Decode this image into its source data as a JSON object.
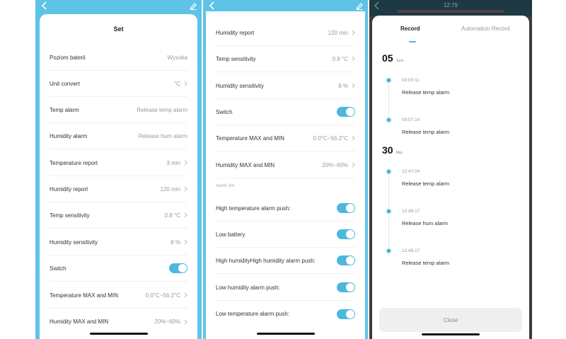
{
  "colors": {
    "accent": "#4db7dd",
    "header": "#5ec3e6"
  },
  "icons": {
    "back": "chevron-left-icon",
    "edit": "pencil-icon",
    "chevron": "chevron-right-icon"
  },
  "panel1": {
    "title": "Set",
    "rows": [
      {
        "label": "Poziom baterii",
        "value": "Wysoka",
        "chevron": false
      },
      {
        "label": "Unit convert",
        "value": "°C",
        "chevron": true
      },
      {
        "label": "Temp alarm",
        "value": "Release temp alarm",
        "chevron": false
      },
      {
        "label": "Humidity alarm",
        "value": "Release hum alarm",
        "chevron": false
      },
      {
        "label": "Temperature report",
        "value": "3 min",
        "chevron": true
      },
      {
        "label": "Humidity report",
        "value": "120 min",
        "chevron": true
      },
      {
        "label": "Temp sensitivity",
        "value": "0.8 °C",
        "chevron": true
      },
      {
        "label": "Humidity sensitivity",
        "value": "8 %",
        "chevron": true
      },
      {
        "label": "Switch",
        "value": "",
        "toggle": true
      },
      {
        "label": "Temperature MAX and MIN",
        "value": "0.0°C~56.2°C",
        "chevron": true
      },
      {
        "label": "Humidity MAX and MIN",
        "value": "20%~60%",
        "chevron": true
      }
    ]
  },
  "panel2": {
    "rows": [
      {
        "label": "Humidity report",
        "value": "120 min"
      },
      {
        "label": "Temp sensitivity",
        "value": "0.8 °C"
      },
      {
        "label": "Humidity sensitivity",
        "value": "8 %"
      },
      {
        "label": "Switch",
        "value": ""
      },
      {
        "label": "Temperature MAX and MIN",
        "value": "0.0°C~56.2°C"
      },
      {
        "label": "Humidity MAX and MIN",
        "value": "20%~60%"
      }
    ],
    "section_label": "Alarm Set",
    "alarms": [
      {
        "label": "High temperature alarm push:"
      },
      {
        "label": "Low battery"
      },
      {
        "label": "High humidityHigh humidity alarm push:"
      },
      {
        "label": "Low humidity alarm push:"
      },
      {
        "label": "Low temperature alarm push:"
      }
    ]
  },
  "panel3": {
    "status_time": "12:79",
    "tabs": {
      "record": "Record",
      "automation": "Automation Record"
    },
    "days": [
      {
        "day": "05",
        "month": "June"
      },
      {
        "day": "30",
        "month": "May"
      }
    ],
    "events": [
      {
        "time": "09:00:11",
        "text": "Release temp alarm"
      },
      {
        "time": "08:57:14",
        "text": "Release temp alarm"
      },
      {
        "time": "12:47:04",
        "text": "Release temp alarm"
      },
      {
        "time": "12:46:17",
        "text": "Release hum alarm"
      },
      {
        "time": "12:46:17",
        "text": "Release temp alarm"
      }
    ],
    "close_label": "Close"
  }
}
